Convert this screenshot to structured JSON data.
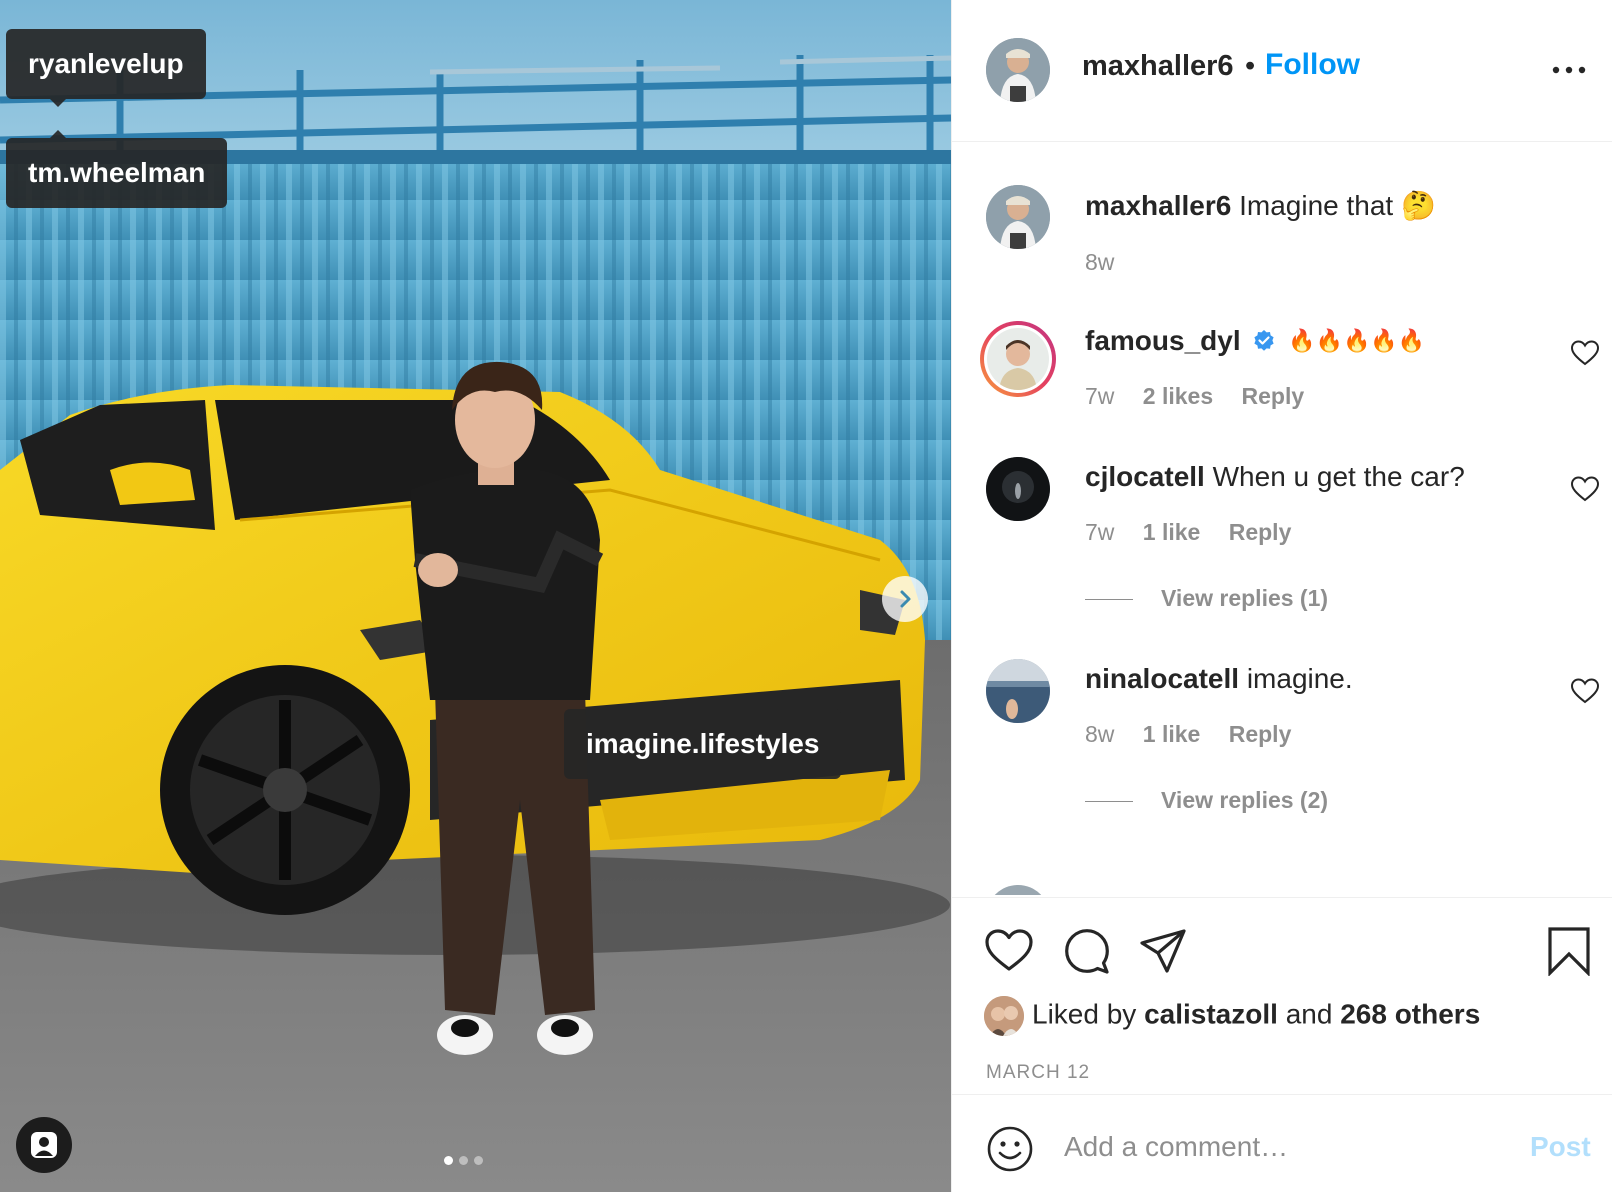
{
  "photo": {
    "tags": [
      "ryanlevelup",
      "tm.wheelman",
      "imagine.lifestyles"
    ],
    "carousel": {
      "total": 3,
      "current": 1
    }
  },
  "header": {
    "username": "maxhaller6",
    "separator": "•",
    "follow_label": "Follow"
  },
  "comments": [
    {
      "username": "maxhaller6",
      "text": "Imagine that 🤔",
      "time": "8w"
    },
    {
      "username": "famous_dyl",
      "verified": true,
      "text": "🔥🔥🔥🔥🔥",
      "time": "7w",
      "likes": "2 likes",
      "reply_label": "Reply"
    },
    {
      "username": "cjlocatell",
      "text": "When u get the car?",
      "time": "7w",
      "likes": "1 like",
      "reply_label": "Reply",
      "view_replies": "View replies (1)"
    },
    {
      "username": "ninalocatell",
      "text": "imagine.",
      "time": "8w",
      "likes": "1 like",
      "reply_label": "Reply",
      "view_replies": "View replies (2)"
    }
  ],
  "likes": {
    "prefix": "Liked by",
    "user": "calistazoll",
    "middle": "and",
    "others": "268 others"
  },
  "date": "MARCH 12",
  "comment_box": {
    "placeholder": "Add a comment…",
    "post_label": "Post"
  },
  "colors": {
    "accent": "#0095f6",
    "post_disabled": "#b2dffc",
    "muted": "#8e8e8e",
    "car_yellow": "#f4cf16",
    "container_blue": "#5aa9cc"
  }
}
